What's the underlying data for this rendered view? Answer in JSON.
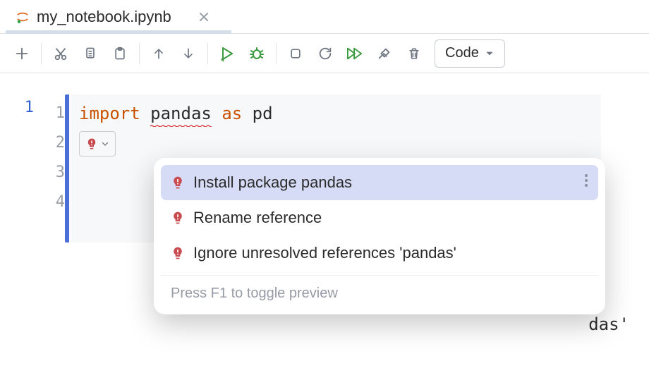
{
  "tab": {
    "filename": "my_notebook.ipynb"
  },
  "toolbar": {
    "cell_type": "Code"
  },
  "gutter": {
    "exec_count": "1",
    "lines": [
      "1",
      "2",
      "3",
      "4"
    ]
  },
  "code": {
    "kw_import": "import",
    "module": "pandas",
    "kw_as": "as",
    "alias": "pd"
  },
  "intentions": {
    "items": [
      {
        "label": "Install package pandas",
        "selected": true
      },
      {
        "label": "Rename reference",
        "selected": false
      },
      {
        "label": "Ignore unresolved references 'pandas'",
        "selected": false
      }
    ],
    "footer": "Press F1 to toggle preview"
  },
  "trailing": "das'"
}
